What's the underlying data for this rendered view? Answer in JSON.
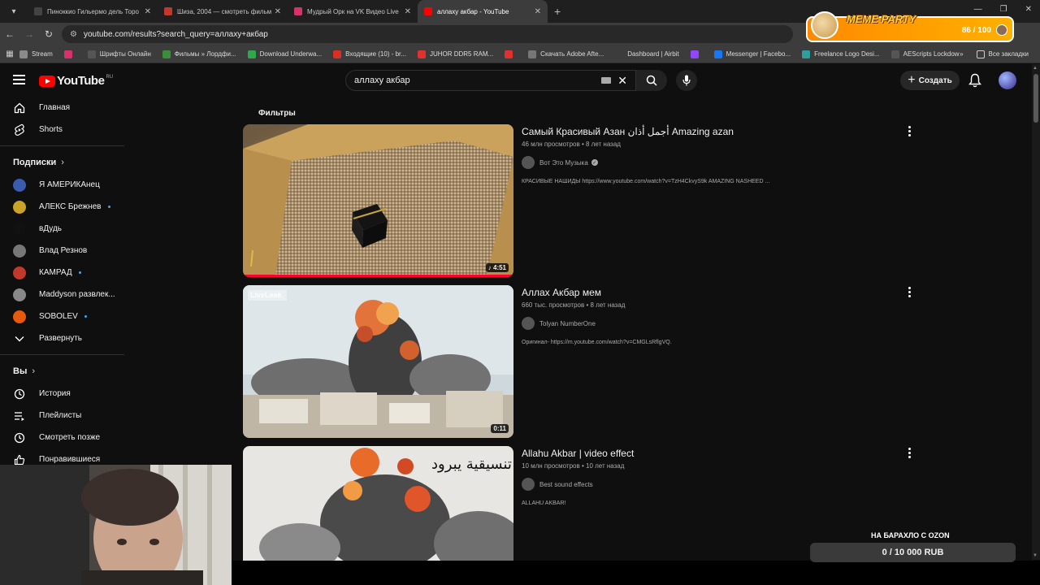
{
  "browser": {
    "tabs": [
      {
        "title": "Пиноккио Гильермо дель Торо",
        "color": "#444444"
      },
      {
        "title": "Шиза, 2004 — смотреть фильм",
        "color": "#c0392b"
      },
      {
        "title": "Мудрый Орк на VK Видео Live",
        "color": "#d6336c"
      },
      {
        "title": "аллаху акбар - YouTube",
        "color": "#ff0000"
      }
    ],
    "url": "youtube.com/results?search_query=аллаху+акбар",
    "bookmarks": [
      {
        "label": "Stream",
        "color": "#8a8a8a"
      },
      {
        "label": "",
        "color": "#d6336c"
      },
      {
        "label": "Шрифты Онлайн",
        "color": "#555555"
      },
      {
        "label": "Фильмы » Лордфи...",
        "color": "#3a8e3a"
      },
      {
        "label": "Download Underwa...",
        "color": "#2eaa4a"
      },
      {
        "label": "Входящие (10) - br...",
        "color": "#d93025"
      },
      {
        "label": "JUHOR DDR5 RAM...",
        "color": "#e03131"
      },
      {
        "label": "",
        "color": "#e03131"
      },
      {
        "label": "Скачать Adobe Afte...",
        "color": "#777777"
      },
      {
        "label": "Dashboard | Airbit",
        "color": "#3c3c3c"
      },
      {
        "label": "",
        "color": "#9146ff"
      },
      {
        "label": "Messenger | Facebo...",
        "color": "#1877f2"
      },
      {
        "label": "Freelance Logo Desi...",
        "color": "#2f9e9e"
      },
      {
        "label": "AEScripts Lockdown...",
        "color": "#555555"
      }
    ],
    "more_bookmarks": "»",
    "all_bookmarks": "Все закладки"
  },
  "overlay": {
    "meme_title": "MEME PARTY",
    "meme_count": "86 / 100",
    "ozon_label": "НА БАРАХЛО С OZON",
    "ozon_value": "0 / 10 000 RUB"
  },
  "header": {
    "logo_text": "YouTube",
    "region": "RU",
    "search_value": "аллаху акбар",
    "create_label": "Создать"
  },
  "sidebar": {
    "main": [
      {
        "label": "Главная",
        "icon": "home-icon"
      },
      {
        "label": "Shorts",
        "icon": "shorts-icon"
      }
    ],
    "subs_title": "Подписки",
    "subs": [
      {
        "label": "Я АМЕРИКАнец",
        "color": "#3a5bb0",
        "dot": false
      },
      {
        "label": "АЛЕКС Брежнев",
        "color": "#c9a227",
        "dot": true
      },
      {
        "label": "вДудь",
        "color": "#111111",
        "dot": false
      },
      {
        "label": "Влад Резнов",
        "color": "#777777",
        "dot": false
      },
      {
        "label": "КАМРАД",
        "color": "#c0392b",
        "dot": true
      },
      {
        "label": "Maddyson развлек...",
        "color": "#888888",
        "dot": false
      },
      {
        "label": "SOBOLEV",
        "color": "#e8590c",
        "dot": true
      }
    ],
    "expand_label": "Развернуть",
    "you_title": "Вы",
    "you": [
      {
        "label": "История",
        "icon": "history-icon"
      },
      {
        "label": "Плейлисты",
        "icon": "playlists-icon"
      },
      {
        "label": "Смотреть позже",
        "icon": "watch-later-icon"
      },
      {
        "label": "Понравившиеся",
        "icon": "like-icon"
      }
    ]
  },
  "filters_label": "Фильтры",
  "results": [
    {
      "title": "Самый Красивый Азан أجمل أذان Amazing azan",
      "meta": "46 млн просмотров • 8 лет назад",
      "channel": "Вот Это Музыка",
      "verified": true,
      "desc": "КРАСИВЫЕ НАШИДЫ https://www.youtube.com/watch?v=TzH4CkvyS9k AMAZING NASHEED ...",
      "duration": "♪ 4:51",
      "watched": true
    },
    {
      "title": "Аллах Акбар мем",
      "meta": "660 тыс. просмотров • 8 лет назад",
      "channel": "Tolyan NumberOne",
      "verified": false,
      "desc": "Оригинал- https://m.youtube.com/watch?v=CMGLsRflgVQ.",
      "duration": "0:11",
      "watermark": "LiveLeak",
      "watched": false
    },
    {
      "title": "Allahu Akbar | video effect",
      "meta": "10 млн просмотров • 10 лет назад",
      "channel": "Best sound effects",
      "verified": false,
      "desc": "ALLAHU AKBAR!",
      "overlay_text": "تنسيقية يبرود",
      "watched": false
    }
  ]
}
